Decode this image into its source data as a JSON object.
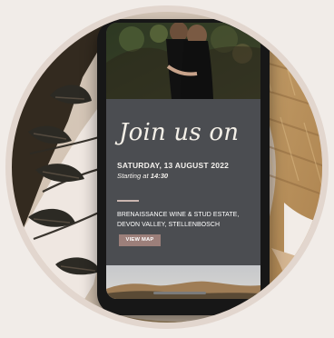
{
  "invitation": {
    "heading": "Join us on",
    "date": "SATURDAY, 13 AUGUST 2022",
    "time_prefix": "Starting at ",
    "time": "14:30",
    "venue_line_1": "BRENAISSANCE WINE & STUD ESTATE,",
    "venue_line_2": "DEVON VALLEY, STELLENBOSCH",
    "map_button": "VIEW MAP"
  },
  "colors": {
    "outer_background": "#f1ece8",
    "ring": "#e2d6ce",
    "screen_card": "#4b4d51",
    "button": "#9c7f7a"
  }
}
